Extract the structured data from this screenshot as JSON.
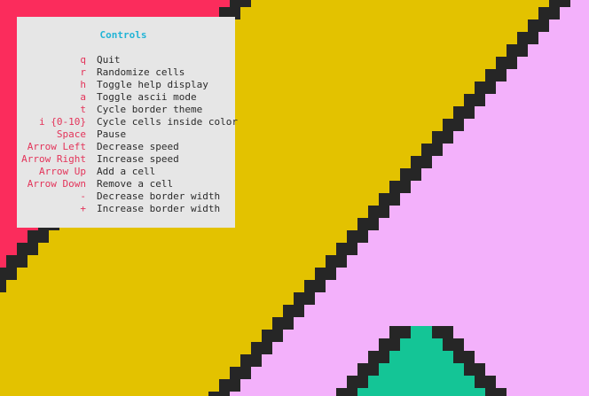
{
  "colors": {
    "background": "#e3c200",
    "left_cell": "#fb2c5c",
    "right_cell": "#f3b1fb",
    "bottom_cell": "#14c596",
    "border": "#262626",
    "panel_bg": "#e6e6e6",
    "title": "#22b4d6",
    "key": "#e3345a",
    "desc": "#2b2b2b"
  },
  "help": {
    "title": "Controls",
    "items": [
      {
        "key": "q",
        "desc": "Quit"
      },
      {
        "key": "r",
        "desc": "Randomize cells"
      },
      {
        "key": "h",
        "desc": "Toggle help display"
      },
      {
        "key": "a",
        "desc": "Toggle ascii mode"
      },
      {
        "key": "t",
        "desc": "Cycle border theme"
      },
      {
        "key": "i {0-10}",
        "desc": "Cycle cells inside color"
      },
      {
        "key": "Space",
        "desc": "Pause"
      },
      {
        "key": "Arrow Left",
        "desc": "Decrease speed"
      },
      {
        "key": "Arrow Right",
        "desc": "Increase speed"
      },
      {
        "key": "Arrow Up",
        "desc": "Add a cell"
      },
      {
        "key": "Arrow Down",
        "desc": "Remove a cell"
      },
      {
        "key": "-",
        "desc": "Decrease border width"
      },
      {
        "key": "+",
        "desc": "Increase border width"
      }
    ]
  }
}
